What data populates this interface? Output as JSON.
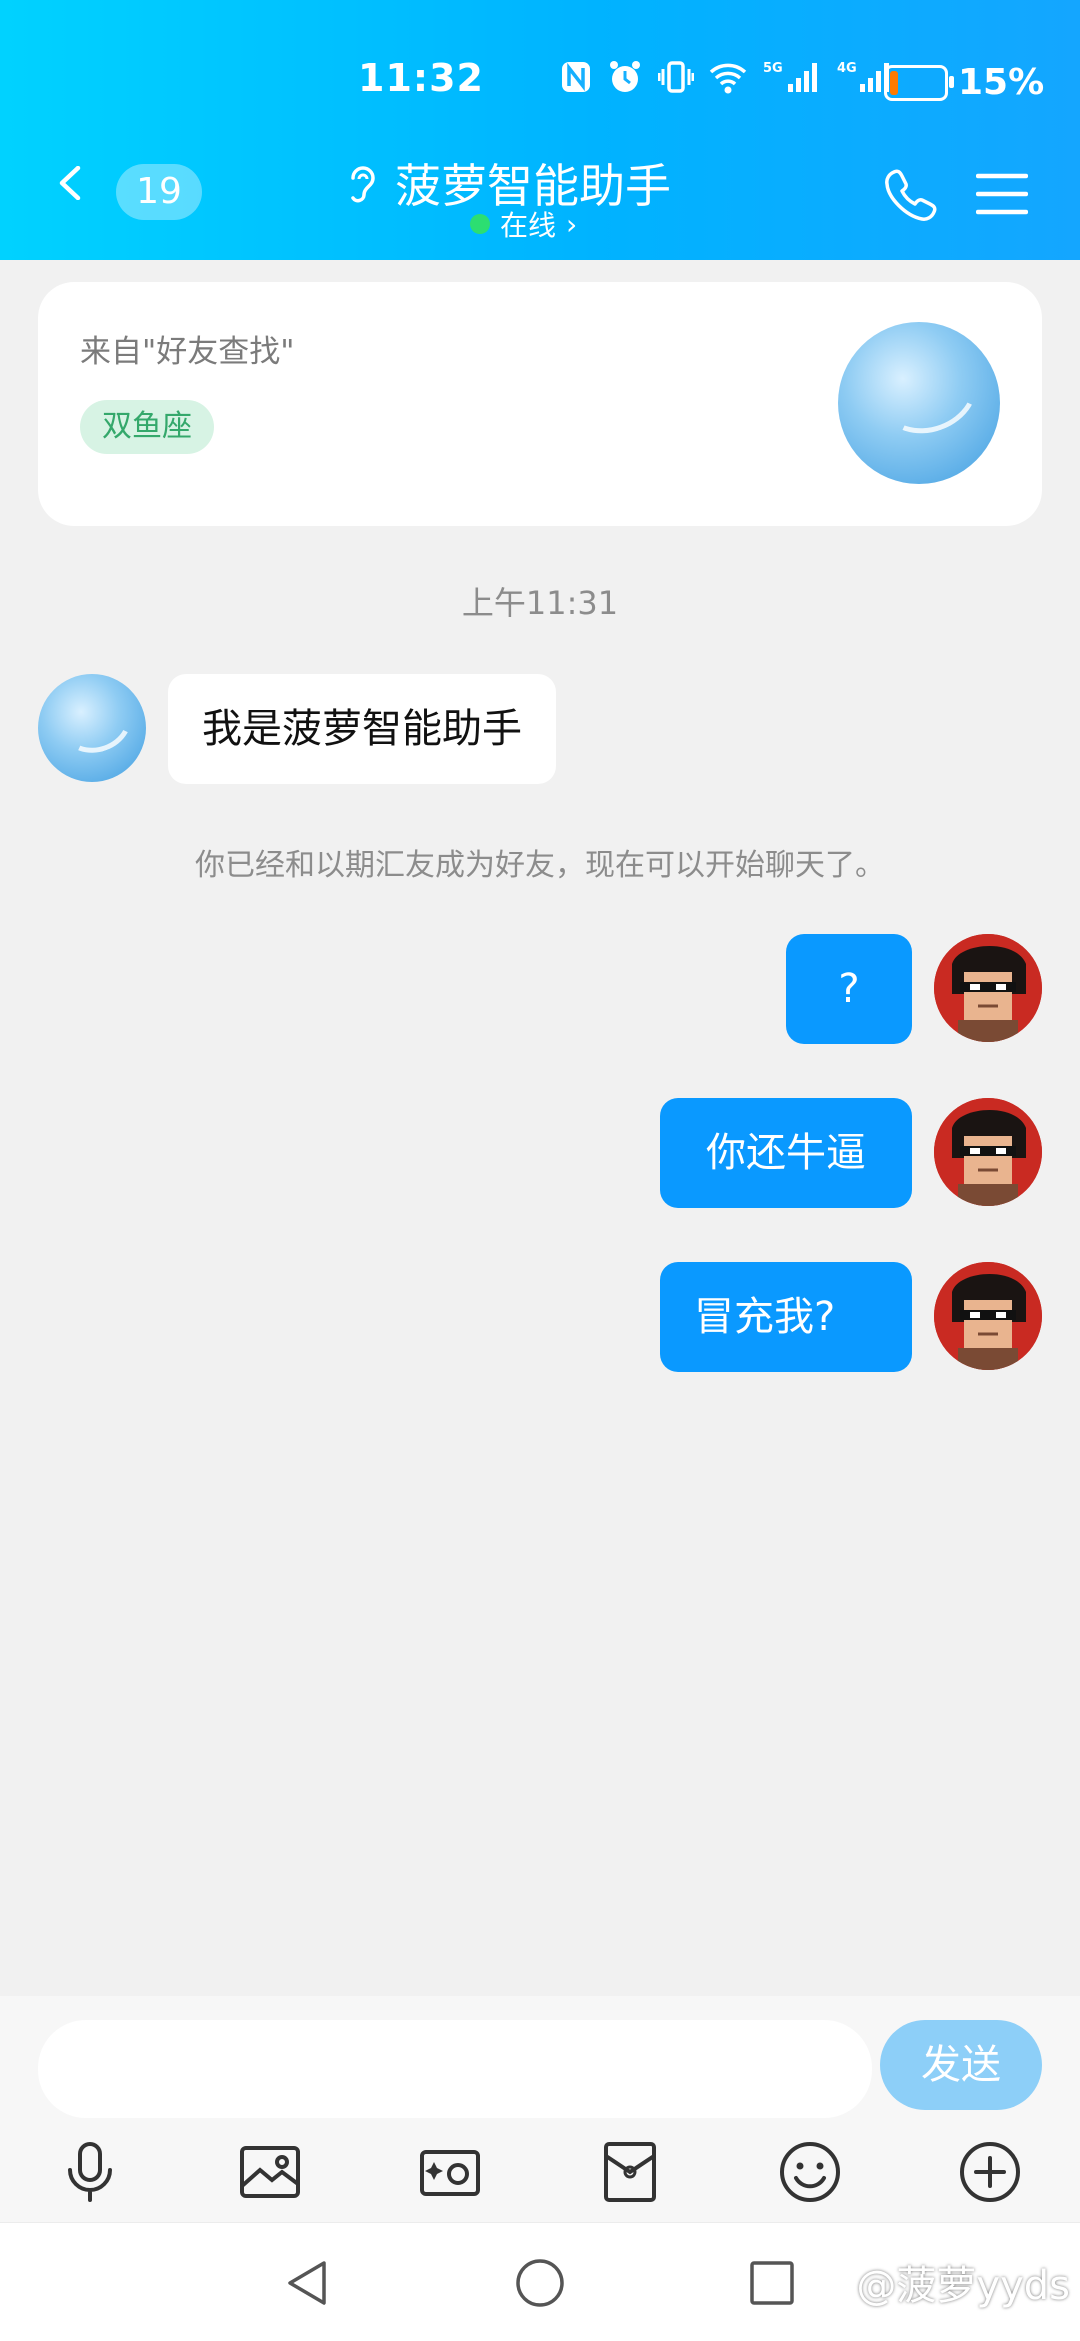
{
  "status_bar": {
    "time": "11:32",
    "battery_percent": "15%",
    "battery_level": 0.15,
    "network_labels": [
      "5G",
      "4G"
    ]
  },
  "header": {
    "back_count": "19",
    "title": "菠萝智能助手",
    "status": "在线",
    "status_chevron": "›"
  },
  "profile_card": {
    "source_text": "来自\"好友查找\"",
    "tag": "双鱼座"
  },
  "chat": {
    "timestamp": "上午11:31",
    "incoming": [
      {
        "text": "我是菠萝智能助手"
      }
    ],
    "system_notice": "你已经和以期汇友成为好友，现在可以开始聊天了。",
    "outgoing": [
      {
        "text": "?"
      },
      {
        "text": "你还牛逼"
      },
      {
        "text": "冒充我?"
      }
    ]
  },
  "input_bar": {
    "placeholder": "",
    "send_label": "发送",
    "tools": [
      "microphone-icon",
      "image-icon",
      "camera-icon",
      "red-packet-icon",
      "emoji-icon",
      "plus-icon"
    ]
  },
  "system_nav": {
    "watermark": "@菠萝yyds"
  },
  "colors": {
    "header_gradient_start": "#00d2ff",
    "header_gradient_end": "#14a6ff",
    "outgoing_bubble": "#0a99ff",
    "send_button": "#8dcff8",
    "online_dot": "#2cde71",
    "tag_bg": "#d7f3e4",
    "tag_text": "#34a86b"
  }
}
